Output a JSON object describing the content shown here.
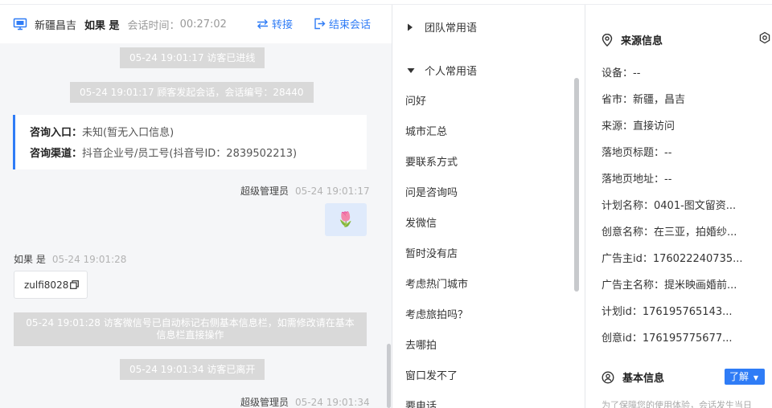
{
  "chat": {
    "header": {
      "region": "新疆昌吉",
      "nickname": "如果 是",
      "session_time_label": "会话时间：",
      "session_time_value": "00:27:02",
      "transfer_label": "转接",
      "end_label": "结束会话"
    },
    "system_msgs": [
      "05-24 19:01:17 访客已进线",
      "05-24 19:01:17 顾客发起会话，会话编号：28440",
      "05-24 19:01:28 访客微信号已自动标记右侧基本信息栏，如需修改请在基本信息栏直接操作",
      "05-24 19:01:34 访客已离开"
    ],
    "info_card": {
      "entry_key": "咨询入口：",
      "entry_value": "未知(暂无入口信息)",
      "channel_key": "咨询渠道：",
      "channel_value": "抖音企业号/员工号(抖音号ID：2839502213)"
    },
    "messages": [
      {
        "sender": "超级管理员",
        "time": "05-24 19:01:17",
        "content": "🌷"
      },
      {
        "sender": "如果 是",
        "time": "05-24 19:01:28",
        "content": "zulfi8028"
      },
      {
        "sender": "超级管理员",
        "time": "05-24 19:01:34"
      }
    ]
  },
  "phrases": {
    "team_group": "团队常用语",
    "personal_group": "个人常用语",
    "items": [
      "问好",
      "城市汇总",
      "要联系方式",
      "问是咨询吗",
      "发微信",
      "暂时没有店",
      "考虑热门城市",
      "考虑旅拍吗？",
      "去哪拍",
      "窗口发不了",
      "要电话"
    ]
  },
  "source_info": {
    "title": "来源信息",
    "fields": [
      "设备：--",
      "省市：新疆，昌吉",
      "来源：直接访问",
      "落地页标题：--",
      "落地页地址：--",
      "计划名称：0401-图文留资...",
      "创意名称：在三亚，拍婚纱...",
      "广告主id：176022240735...",
      "广告主名称：提米映画婚前...",
      "计划id：176195765143...",
      "创意id：176195775677..."
    ]
  },
  "basic_info": {
    "title": "基本信息",
    "learn_more": "了解",
    "notice": "为了保障您的使用体验，会话发生当日"
  },
  "colors": {
    "accent": "#2f7cf6",
    "system_pill": "#d9d9d9",
    "chat_bg": "#f5f6f8"
  }
}
